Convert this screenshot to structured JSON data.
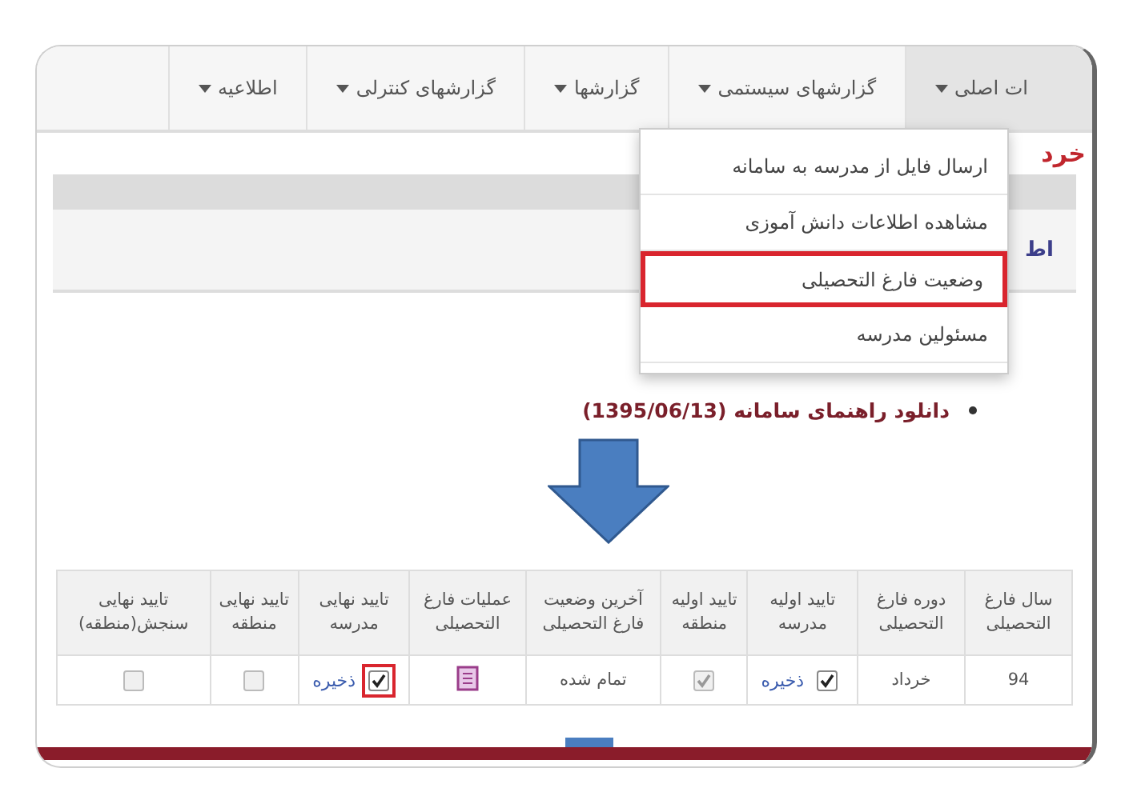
{
  "nav_tabs": [
    {
      "label": "ات اصلی",
      "selected": true
    },
    {
      "label": "گزارشهای سیستمی",
      "selected": false
    },
    {
      "label": "گزارشها",
      "selected": false
    },
    {
      "label": "گزارشهای کنترلی",
      "selected": false
    },
    {
      "label": "اطلاعیه",
      "selected": false
    }
  ],
  "dropdown_menu": [
    {
      "label": "ارسال فایل از مدرسه به سامانه",
      "highlighted": false
    },
    {
      "label": "مشاهده اطلاعات دانش آموزی",
      "highlighted": false
    },
    {
      "label": "وضعیت فارغ التحصیلی",
      "highlighted": true
    },
    {
      "label": "مسئولین مدرسه",
      "highlighted": false
    }
  ],
  "page_title": "خرد",
  "panel_text": "اط",
  "download_link": "دانلود راهنمای سامانه (1395/06/13)",
  "table": {
    "columns": [
      "سال فارغ التحصیلی",
      "دوره فارغ التحصیلی",
      "تایید اولیه مدرسه",
      "تایید اولیه منطقه",
      "آخرین وضعیت فارغ التحصیلی",
      "عملیات فارغ التحصیلی",
      "تایید نهایی مدرسه",
      "تایید نهایی منطقه",
      "تایید نهایی سنجش(منطقه)"
    ],
    "rows": [
      {
        "cells": [
          {
            "kind": "text",
            "text": "94"
          },
          {
            "kind": "text",
            "text": "خرداد"
          },
          {
            "kind": "check",
            "checked": true,
            "disabled": false,
            "link": "ذخیره"
          },
          {
            "kind": "check",
            "checked": true,
            "disabled": true
          },
          {
            "kind": "text",
            "text": "تمام شده"
          },
          {
            "kind": "icon"
          },
          {
            "kind": "check",
            "checked": true,
            "disabled": false,
            "highlighted": true,
            "link": "ذخیره"
          },
          {
            "kind": "check",
            "checked": false,
            "disabled": true
          },
          {
            "kind": "check",
            "checked": false,
            "disabled": true
          }
        ]
      }
    ]
  }
}
